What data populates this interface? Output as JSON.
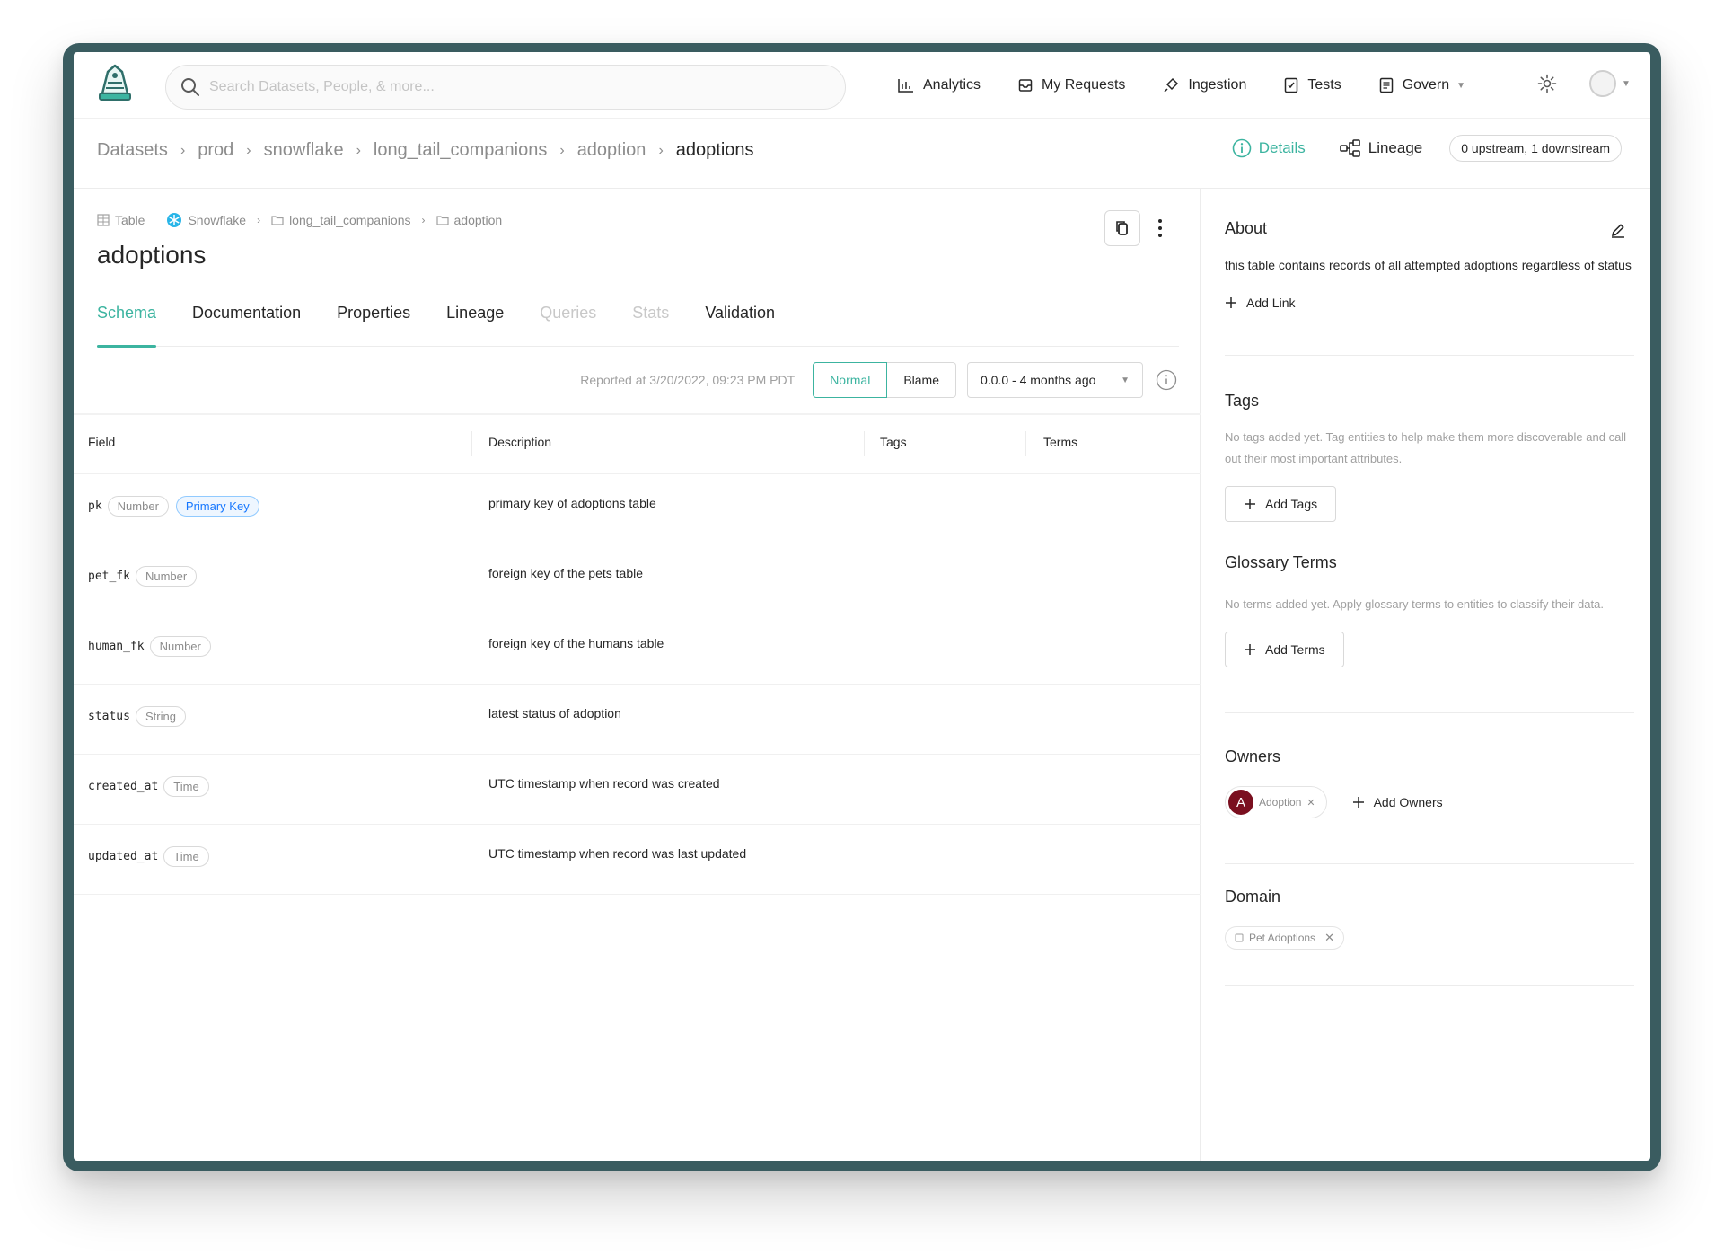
{
  "colors": {
    "accent": "#3cb4a0",
    "frame": "#3a5c60",
    "owner_avatar": "#7a0f1f",
    "key_pill": "#1677ff"
  },
  "search": {
    "placeholder": "Search Datasets, People, & more..."
  },
  "nav": {
    "analytics": "Analytics",
    "requests": "My Requests",
    "ingestion": "Ingestion",
    "tests": "Tests",
    "govern": "Govern"
  },
  "breadcrumb": {
    "items": [
      "Datasets",
      "prod",
      "snowflake",
      "long_tail_companions",
      "adoption"
    ],
    "current": "adoptions"
  },
  "header_right": {
    "details": "Details",
    "lineage": "Lineage",
    "lineage_counts": "0 upstream, 1 downstream"
  },
  "entity": {
    "type": "Table",
    "platform": "Snowflake",
    "path": [
      "long_tail_companions",
      "adoption"
    ],
    "title": "adoptions"
  },
  "tabs": [
    {
      "label": "Schema",
      "state": "active"
    },
    {
      "label": "Documentation",
      "state": "normal"
    },
    {
      "label": "Properties",
      "state": "normal"
    },
    {
      "label": "Lineage",
      "state": "normal"
    },
    {
      "label": "Queries",
      "state": "disabled"
    },
    {
      "label": "Stats",
      "state": "disabled"
    },
    {
      "label": "Validation",
      "state": "normal"
    }
  ],
  "toolbar": {
    "reported": "Reported at 3/20/2022, 09:23 PM PDT",
    "normal": "Normal",
    "blame": "Blame",
    "version": "0.0.0 - 4 months ago"
  },
  "schema": {
    "columns": [
      "Field",
      "Description",
      "Tags",
      "Terms"
    ],
    "rows": [
      {
        "name": "pk",
        "type": "Number",
        "key": "Primary Key",
        "description": "primary key of adoptions table"
      },
      {
        "name": "pet_fk",
        "type": "Number",
        "key": "",
        "description": "foreign key of the pets table"
      },
      {
        "name": "human_fk",
        "type": "Number",
        "key": "",
        "description": "foreign key of the humans table"
      },
      {
        "name": "status",
        "type": "String",
        "key": "",
        "description": "latest status of adoption"
      },
      {
        "name": "created_at",
        "type": "Time",
        "key": "",
        "description": "UTC timestamp when record was created"
      },
      {
        "name": "updated_at",
        "type": "Time",
        "key": "",
        "description": "UTC timestamp when record was last updated"
      }
    ]
  },
  "sidebar": {
    "about": {
      "title": "About",
      "text": "this table contains records of all attempted adoptions regardless of status",
      "add_link": "Add Link"
    },
    "tags": {
      "title": "Tags",
      "empty": "No tags added yet. Tag entities to help make them more discoverable and call out their most important attributes.",
      "add": "Add Tags"
    },
    "glossary": {
      "title": "Glossary Terms",
      "empty": "No terms added yet. Apply glossary terms to entities to classify their data.",
      "add": "Add Terms"
    },
    "owners": {
      "title": "Owners",
      "owner_initial": "A",
      "owner_name": "Adoption",
      "add": "Add Owners"
    },
    "domain": {
      "title": "Domain",
      "value": "Pet Adoptions"
    }
  }
}
